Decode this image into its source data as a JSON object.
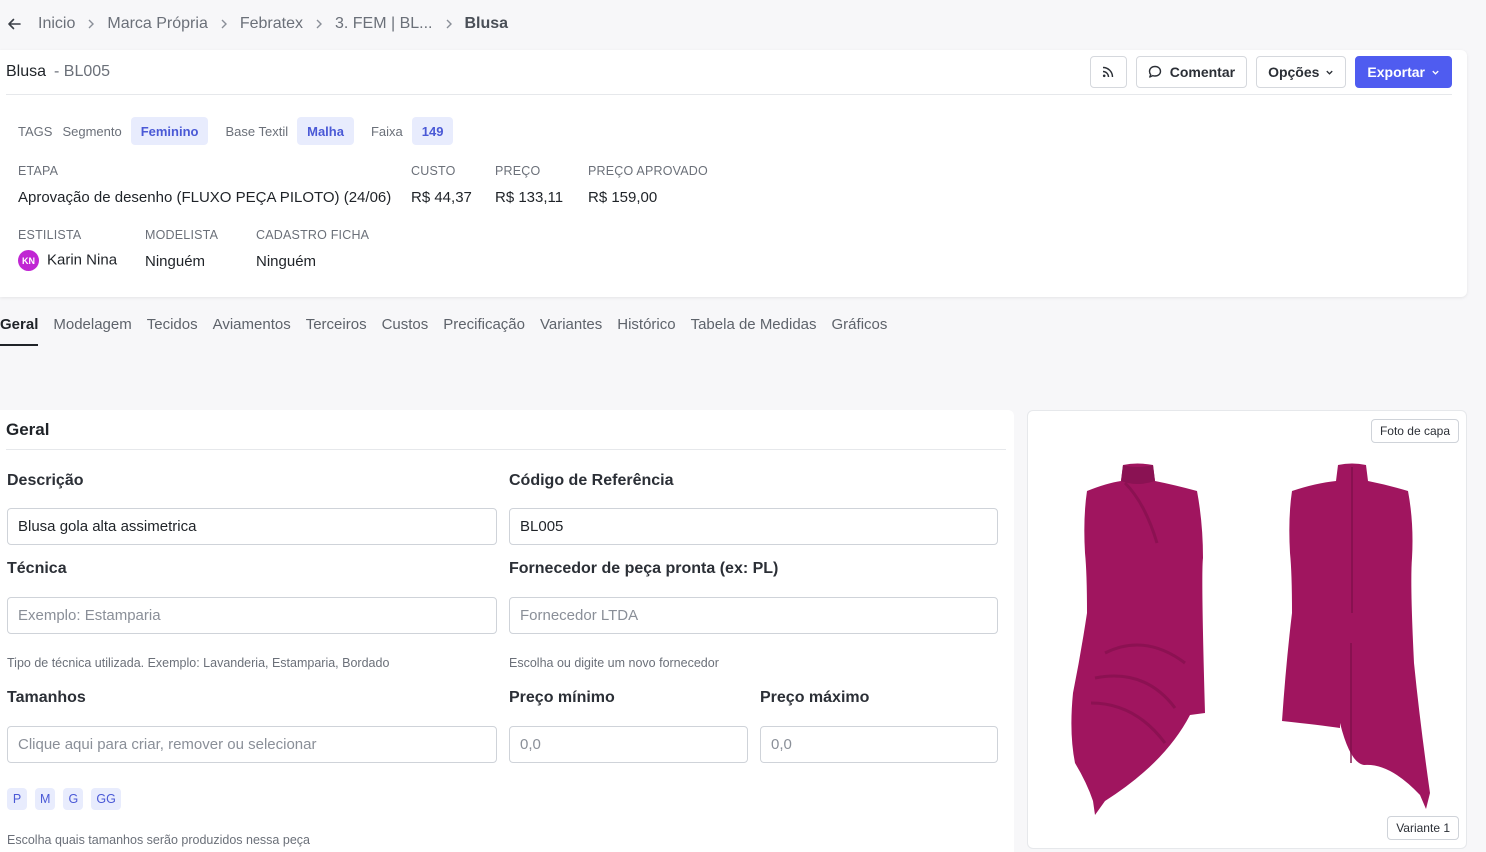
{
  "breadcrumb": [
    "Inicio",
    "Marca Própria",
    "Febratex",
    "3. FEM | BL...",
    "Blusa"
  ],
  "header": {
    "title": "Blusa",
    "code": "- BL005",
    "comment_label": "Comentar",
    "options_label": "Opções",
    "export_label": "Exportar"
  },
  "tags": {
    "label": "TAGS",
    "items": [
      {
        "key": "Segmento",
        "value": "Feminino"
      },
      {
        "key": "Base Textil",
        "value": "Malha"
      },
      {
        "key": "Faixa",
        "value": "149"
      }
    ]
  },
  "info": {
    "etapa_label": "ETAPA",
    "etapa_value": "Aprovação de desenho (FLUXO PEÇA PILOTO) (24/06)",
    "custo_label": "CUSTO",
    "custo_value": "R$ 44,37",
    "preco_label": "PREÇO",
    "preco_value": "R$ 133,11",
    "aprovado_label": "PREÇO APROVADO",
    "aprovado_value": "R$ 159,00",
    "estilista_label": "ESTILISTA",
    "estilista_initials": "KN",
    "estilista_value": "Karin Nina",
    "modelista_label": "MODELISTA",
    "modelista_value": "Ninguém",
    "cadastro_label": "CADASTRO FICHA",
    "cadastro_value": "Ninguém"
  },
  "tabs": [
    "Geral",
    "Modelagem",
    "Tecidos",
    "Aviamentos",
    "Terceiros",
    "Custos",
    "Precificação",
    "Variantes",
    "Histórico",
    "Tabela de Medidas",
    "Gráficos"
  ],
  "form": {
    "section_title": "Geral",
    "descricao_label": "Descrição",
    "descricao_value": "Blusa gola alta assimetrica",
    "codigo_label": "Código de Referência",
    "codigo_value": "BL005",
    "tecnica_label": "Técnica",
    "tecnica_placeholder": "Exemplo: Estamparia",
    "tecnica_help": "Tipo de técnica utilizada. Exemplo: Lavanderia, Estamparia, Bordado",
    "fornecedor_label": "Fornecedor de peça pronta (ex: PL)",
    "fornecedor_placeholder": "Fornecedor LTDA",
    "fornecedor_help": "Escolha ou digite um novo fornecedor",
    "tamanhos_label": "Tamanhos",
    "tamanhos_placeholder": "Clique aqui para criar, remover ou selecionar",
    "tamanhos": [
      "P",
      "M",
      "G",
      "GG"
    ],
    "tamanhos_help": "Escolha quais tamanhos serão produzidos nessa peça",
    "preco_min_label": "Preço mínimo",
    "preco_min_placeholder": "0,0",
    "preco_max_label": "Preço máximo",
    "preco_max_placeholder": "0,0"
  },
  "image": {
    "cover_label": "Foto de capa",
    "variant_label": "Variante 1",
    "garment_color": "#a0155f"
  }
}
